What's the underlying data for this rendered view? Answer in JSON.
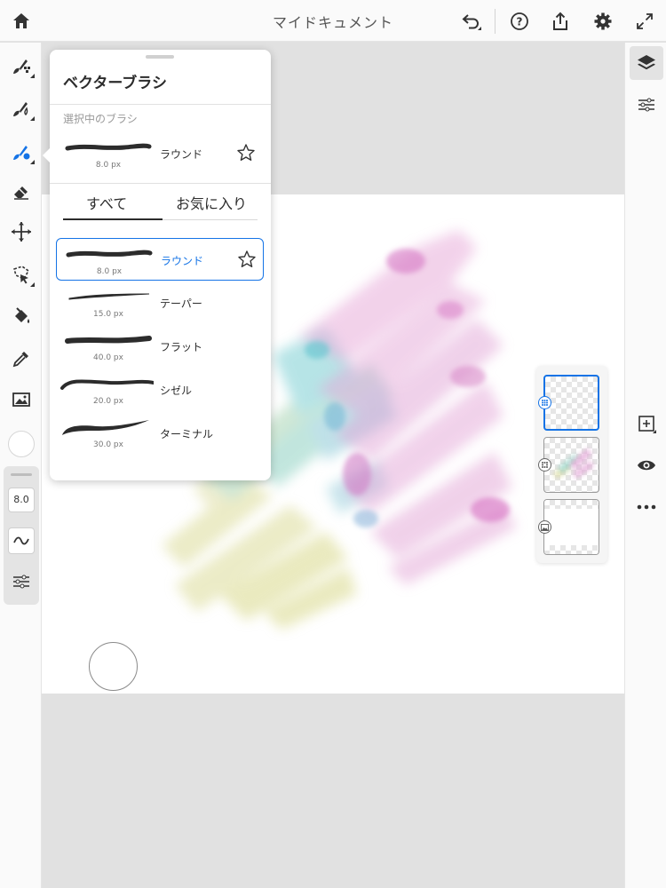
{
  "app": {
    "title": "マイドキュメント"
  },
  "popup": {
    "title": "ベクターブラシ",
    "current_section": "選択中のブラシ",
    "current_brush": {
      "name": "ラウンド",
      "size": "8.0 px"
    },
    "tabs": [
      {
        "label": "すべて",
        "active": true
      },
      {
        "label": "お気に入り",
        "active": false
      }
    ],
    "brushes": [
      {
        "name": "ラウンド",
        "size": "8.0 px",
        "selected": true,
        "favoritable": true
      },
      {
        "name": "テーパー",
        "size": "15.0 px",
        "selected": false
      },
      {
        "name": "フラット",
        "size": "40.0 px",
        "selected": false
      },
      {
        "name": "シゼル",
        "size": "20.0 px",
        "selected": false
      },
      {
        "name": "ターミナル",
        "size": "30.0 px",
        "selected": false
      }
    ]
  },
  "brush_settings": {
    "size_value": "8.0"
  },
  "colors": {
    "accent": "#1473e6",
    "current_color": "#ffffff"
  },
  "icons": {
    "top": [
      "home-icon",
      "undo-icon",
      "help-icon",
      "share-icon",
      "settings-icon",
      "fullscreen-icon"
    ],
    "left": [
      "pixel-brush-icon",
      "live-brush-icon",
      "vector-brush-icon",
      "eraser-icon",
      "transform-icon",
      "lasso-icon",
      "fill-icon",
      "eyedropper-icon",
      "image-icon"
    ],
    "right": [
      "layers-icon",
      "adjust-icon",
      "add-layer-icon",
      "visibility-icon",
      "more-icon"
    ]
  },
  "layers": [
    {
      "type": "vector",
      "selected": true
    },
    {
      "type": "pixel",
      "selected": false
    },
    {
      "type": "image",
      "selected": false
    }
  ]
}
